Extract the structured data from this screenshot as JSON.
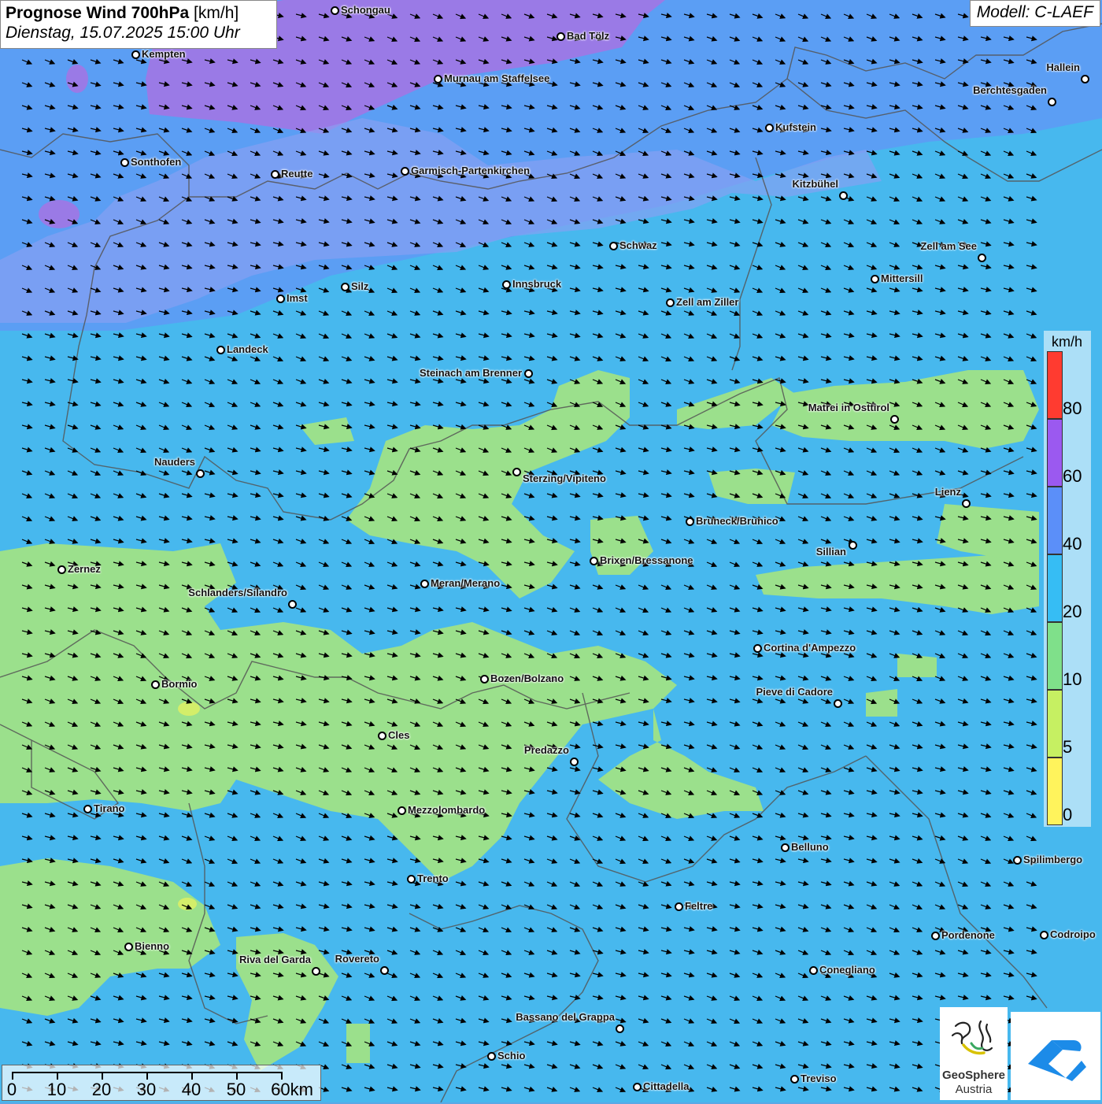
{
  "header": {
    "title_bold": "Prognose Wind 700hPa",
    "title_unit": "[km/h]",
    "subtitle": "Dienstag, 15.07.2025 15:00 Uhr",
    "model": "Modell: C-LAEF"
  },
  "legend": {
    "unit": "km/h",
    "labels": [
      "80",
      "60",
      "40",
      "20",
      "10",
      "5",
      "0"
    ],
    "colors": [
      "#ff3b30",
      "#9b59f0",
      "#5b8ff9",
      "#36bdf4",
      "#7fe08a",
      "#c6f062",
      "#fff35c"
    ]
  },
  "scale_bar": {
    "labels": [
      "0",
      "10",
      "20",
      "30",
      "40",
      "50",
      "60km"
    ]
  },
  "colors": {
    "purple": "#9a7ae6",
    "blue_dark": "#6b9af5",
    "blue_mid": "#51a4ee",
    "cyan": "#45c1ef",
    "green": "#9be08c",
    "yellow_green": "#d4ee6a",
    "border": "#555555"
  },
  "wind": {
    "prevailing_direction": "west-northwest"
  },
  "cities": [
    {
      "name": "Schongau"
    },
    {
      "name": "Bad Tölz"
    },
    {
      "name": "Kempten"
    },
    {
      "name": "Murnau am Staffelsee"
    },
    {
      "name": "Hallein"
    },
    {
      "name": "Berchtesgaden"
    },
    {
      "name": "Kufstein"
    },
    {
      "name": "Sonthofen"
    },
    {
      "name": "Reutte"
    },
    {
      "name": "Garmisch-Partenkirchen"
    },
    {
      "name": "Kitzbühel"
    },
    {
      "name": "Schwaz"
    },
    {
      "name": "Zell am See"
    },
    {
      "name": "Mittersill"
    },
    {
      "name": "Innsbruck"
    },
    {
      "name": "Silz"
    },
    {
      "name": "Imst"
    },
    {
      "name": "Zell am Ziller"
    },
    {
      "name": "Landeck"
    },
    {
      "name": "Steinach am Brenner"
    },
    {
      "name": "Matrei in Osttirol"
    },
    {
      "name": "Nauders"
    },
    {
      "name": "Sterzing/Vipiteno"
    },
    {
      "name": "Lienz"
    },
    {
      "name": "Bruneck/Brunico"
    },
    {
      "name": "Sillian"
    },
    {
      "name": "Brixen/Bressanone"
    },
    {
      "name": "Zernez"
    },
    {
      "name": "Meran/Merano"
    },
    {
      "name": "Schlanders/Silandro"
    },
    {
      "name": "Cortina d'Ampezzo"
    },
    {
      "name": "Bozen/Bolzano"
    },
    {
      "name": "Bormio"
    },
    {
      "name": "Pieve di Cadore"
    },
    {
      "name": "Cles"
    },
    {
      "name": "Predazzo"
    },
    {
      "name": "Tirano"
    },
    {
      "name": "Mezzolombardo"
    },
    {
      "name": "Belluno"
    },
    {
      "name": "Spilimbergo"
    },
    {
      "name": "Trento"
    },
    {
      "name": "Feltre"
    },
    {
      "name": "Bienno"
    },
    {
      "name": "Pordenone"
    },
    {
      "name": "Codroipo"
    },
    {
      "name": "Riva del Garda"
    },
    {
      "name": "Rovereto"
    },
    {
      "name": "Conegliano"
    },
    {
      "name": "Bassano del Grappa"
    },
    {
      "name": "Schio"
    },
    {
      "name": "Treviso"
    },
    {
      "name": "Cittadella"
    }
  ],
  "logos": {
    "geosphere_line1": "GeoSphere",
    "geosphere_line2": "Austria"
  }
}
